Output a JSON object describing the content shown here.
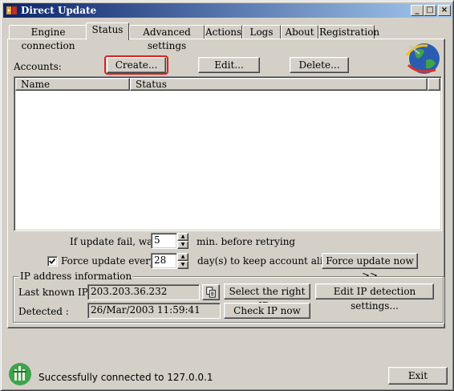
{
  "window": {
    "title": "Direct Update"
  },
  "tabs": [
    {
      "label": "Engine connection"
    },
    {
      "label": "Status"
    },
    {
      "label": "Advanced settings"
    },
    {
      "label": "Actions"
    },
    {
      "label": "Logs"
    },
    {
      "label": "About"
    },
    {
      "label": "Registration"
    }
  ],
  "active_tab": "Status",
  "accounts": {
    "label": "Accounts:",
    "create_label": "Create...",
    "edit_label": "Edit...",
    "delete_label": "Delete...",
    "columns": [
      "Name",
      "Status"
    ],
    "rows": []
  },
  "retry": {
    "prefix": "If update fail, wait",
    "value": "5",
    "suffix": "min.  before retrying"
  },
  "force": {
    "checked": true,
    "label": "Force update every:",
    "value": "28",
    "suffix": "day(s) to keep account alive",
    "button_label": "Force update now >>"
  },
  "ip": {
    "group_title": "IP address information",
    "last_known_label": "Last known IP :",
    "last_known_value": "203.203.36.232",
    "detected_label": "Detected :",
    "detected_value": "26/Mar/2003 11:59:41",
    "select_right_label": "Select the right IP...",
    "edit_detection_label": "Edit IP detection settings...",
    "check_now_label": "Check IP now"
  },
  "statusbar": {
    "message": "Successfully connected to 127.0.0.1",
    "exit_label": "Exit"
  },
  "colors": {
    "highlight_border": "#e0201a",
    "titlebar_start": "#0a246a",
    "titlebar_end": "#a6caf0"
  }
}
